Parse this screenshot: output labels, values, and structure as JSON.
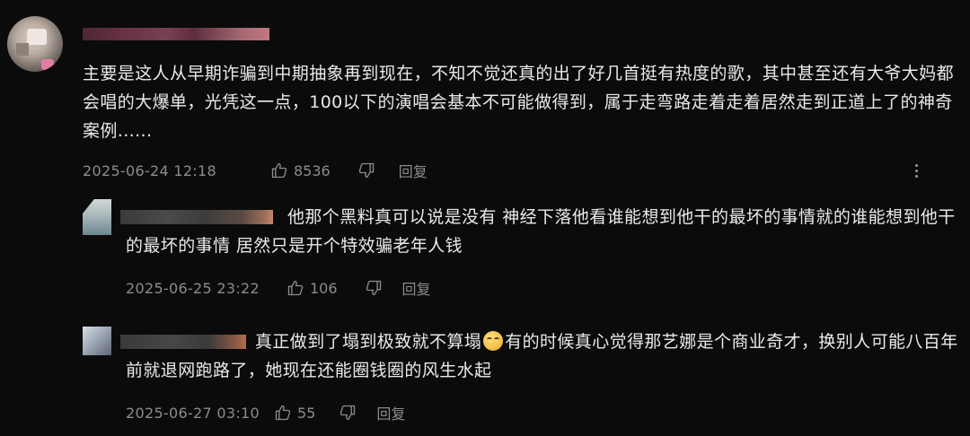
{
  "comment": {
    "text": "主要是这人从早期诈骗到中期抽象再到现在，不知不觉还真的出了好几首挺有热度的歌，其中甚至还有大爷大妈都会唱的大爆单，光凭这一点，100以下的演唱会基本不可能做得到，属于走弯路走着走着居然走到正道上了的神奇案例......",
    "date": "2025-06-24 12:18",
    "likes": "8536",
    "reply_label": "回复"
  },
  "replies": [
    {
      "text": "他那个黑料真可以说是没有 神经下落他看谁能想到他干的最坏的事情就的谁能想到他干的最坏的事情 居然只是开个特效骗老年人钱",
      "date": "2025-06-25 23:22",
      "likes": "106",
      "reply_label": "回复"
    },
    {
      "text_before_emoji": "真正做到了塌到极致就不算塌",
      "text_after_emoji": "有的时候真心觉得那艺娜是个商业奇才，换别人可能八百年前就退网跑路了，她现在还能圈钱圈的风生水起",
      "date": "2025-06-27 03:10",
      "likes": "55",
      "reply_label": "回复"
    }
  ],
  "icons": {
    "like": "thumbs-up-icon",
    "dislike": "thumbs-down-icon",
    "more": "more-vertical-icon",
    "emoji": "eye-roll-emoji"
  }
}
